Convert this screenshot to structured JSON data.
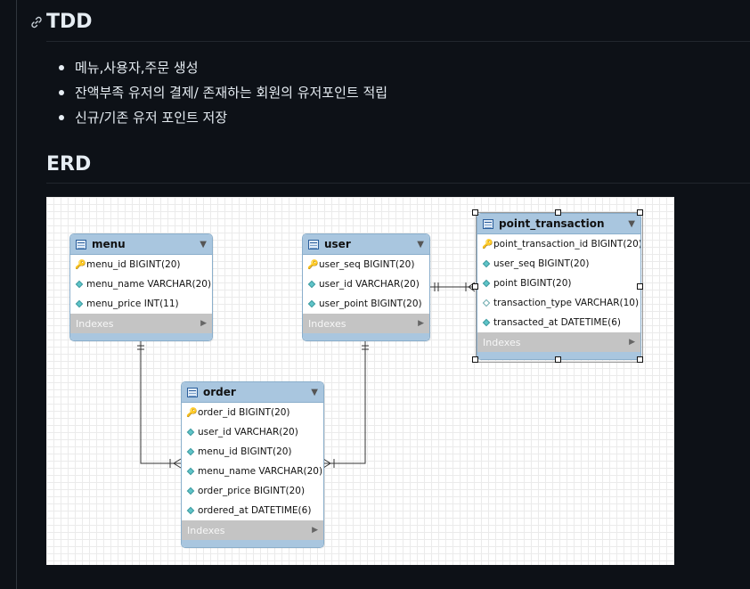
{
  "sections": {
    "tdd_title": "TDD",
    "erd_title": "ERD"
  },
  "bullets": [
    "메뉴,사용자,주문 생성",
    "잔액부족 유저의 결제/ 존재하는 회원의 유저포인트 적립",
    "신규/기존 유저 포인트 저장"
  ],
  "erd": {
    "tables": {
      "menu": {
        "name": "menu",
        "columns": [
          {
            "icon": "key",
            "text": "menu_id BIGINT(20)"
          },
          {
            "icon": "diamond",
            "text": "menu_name VARCHAR(20)"
          },
          {
            "icon": "diamond",
            "text": "menu_price INT(11)"
          }
        ],
        "indexes": "Indexes"
      },
      "user": {
        "name": "user",
        "columns": [
          {
            "icon": "key",
            "text": "user_seq BIGINT(20)"
          },
          {
            "icon": "diamond",
            "text": "user_id VARCHAR(20)"
          },
          {
            "icon": "diamond",
            "text": "user_point BIGINT(20)"
          }
        ],
        "indexes": "Indexes"
      },
      "point_transaction": {
        "name": "point_transaction",
        "columns": [
          {
            "icon": "key",
            "text": "point_transaction_id BIGINT(20)"
          },
          {
            "icon": "diamond",
            "text": "user_seq BIGINT(20)"
          },
          {
            "icon": "diamond",
            "text": "point BIGINT(20)"
          },
          {
            "icon": "diamond-hollow",
            "text": "transaction_type VARCHAR(10)"
          },
          {
            "icon": "diamond",
            "text": "transacted_at DATETIME(6)"
          }
        ],
        "indexes": "Indexes"
      },
      "order": {
        "name": "order",
        "columns": [
          {
            "icon": "key",
            "text": "order_id BIGINT(20)"
          },
          {
            "icon": "diamond",
            "text": "user_id VARCHAR(20)"
          },
          {
            "icon": "diamond",
            "text": "menu_id BIGINT(20)"
          },
          {
            "icon": "diamond",
            "text": "menu_name VARCHAR(20)"
          },
          {
            "icon": "diamond",
            "text": "order_price BIGINT(20)"
          },
          {
            "icon": "diamond",
            "text": "ordered_at DATETIME(6)"
          }
        ],
        "indexes": "Indexes"
      }
    },
    "relationships": [
      {
        "from": "menu",
        "to": "order",
        "from_card": "one-and-only-one",
        "to_card": "zero-or-many"
      },
      {
        "from": "user",
        "to": "order",
        "from_card": "one-and-only-one",
        "to_card": "zero-or-many"
      },
      {
        "from": "user",
        "to": "point_transaction",
        "from_card": "one-and-only-one",
        "to_card": "one-or-many"
      }
    ],
    "selected_table": "point_transaction"
  }
}
